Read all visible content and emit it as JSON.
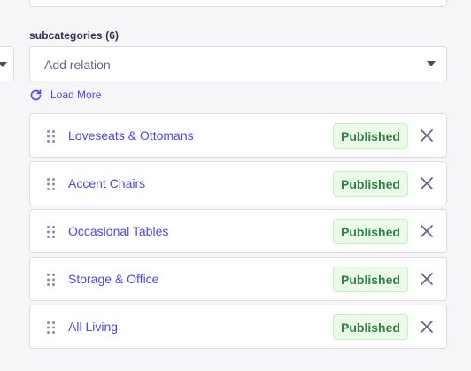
{
  "field": {
    "label": "subcategories (6)",
    "placeholder": "Add relation",
    "load_more_label": "Load More"
  },
  "relations": [
    {
      "name": "Loveseats & Ottomans",
      "status": "Published"
    },
    {
      "name": "Accent Chairs",
      "status": "Published"
    },
    {
      "name": "Occasional Tables",
      "status": "Published"
    },
    {
      "name": "Storage & Office",
      "status": "Published"
    },
    {
      "name": "All Living",
      "status": "Published"
    }
  ],
  "icons": {
    "load_more": "refresh-icon",
    "drag": "drag-handle-icon",
    "remove": "close-icon",
    "select": "chevron-down-icon"
  },
  "colors": {
    "accent": "#4945ff",
    "published_text": "#328048",
    "published_bg": "#eafbe7",
    "published_border": "#c6f0c2",
    "label": "#32324d",
    "border": "#dcdce4",
    "background": "#f6f6f9"
  }
}
